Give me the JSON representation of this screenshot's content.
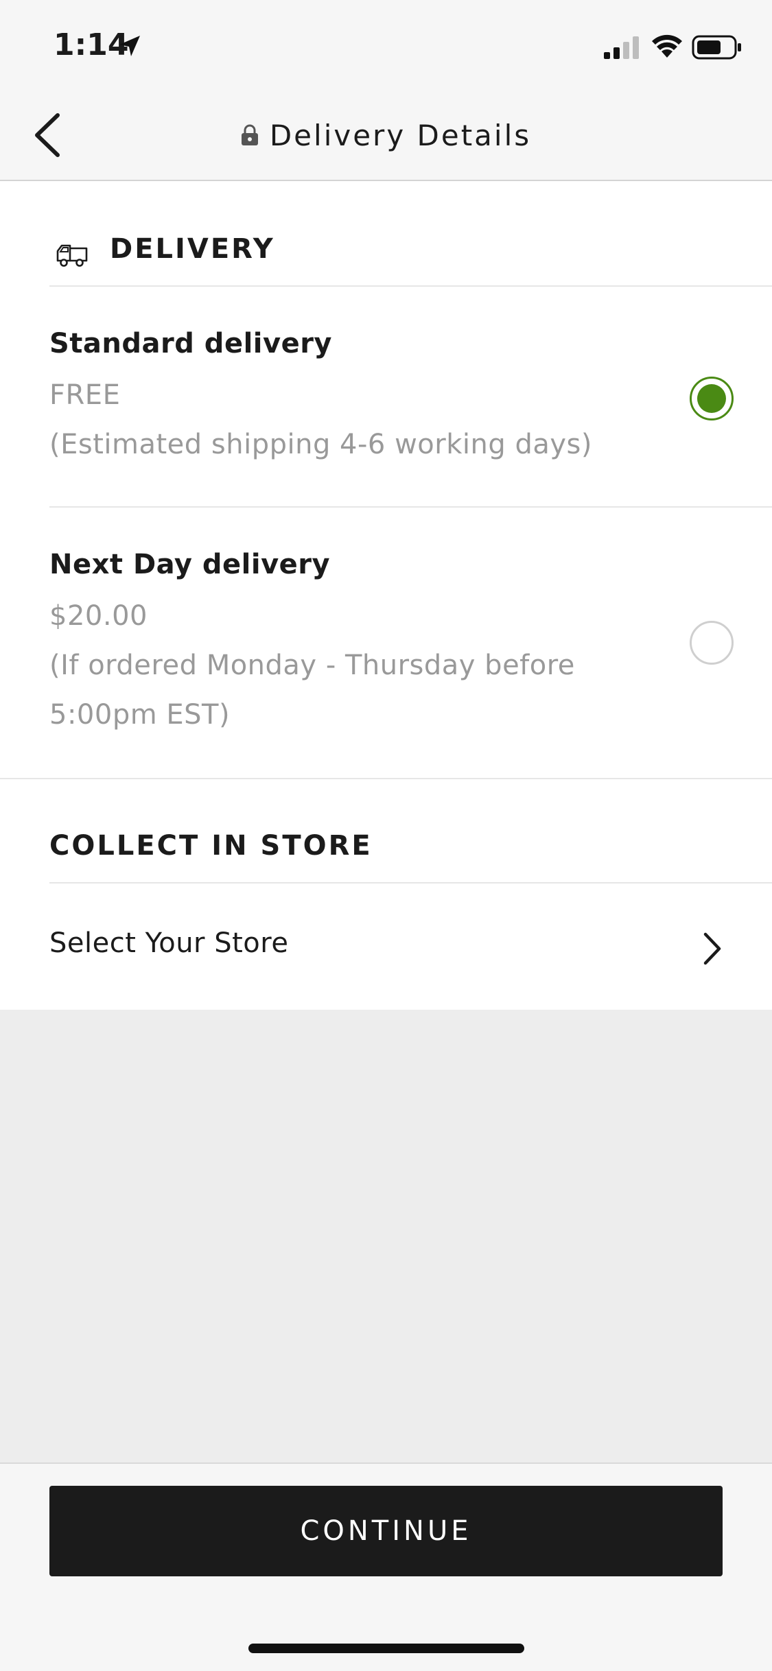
{
  "status_bar": {
    "time": "1:14"
  },
  "nav": {
    "title": "Delivery Details",
    "back_icon": "chevron-left-icon",
    "lock_icon": "lock-icon"
  },
  "delivery_section": {
    "title": "DELIVERY",
    "icon": "truck-icon",
    "options": [
      {
        "title": "Standard delivery",
        "price": "FREE",
        "note_lines": [
          "(Estimated shipping 4-6 working days)"
        ],
        "selected": true
      },
      {
        "title": "Next Day delivery",
        "price": "$20.00",
        "note_lines": [
          "(If ordered Monday - Thursday before",
          "5:00pm EST)"
        ],
        "selected": false
      }
    ]
  },
  "collect_section": {
    "title": "COLLECT IN STORE",
    "select_store_label": "Select Your Store"
  },
  "footer": {
    "continue_label": "CONTINUE"
  },
  "colors": {
    "accent_green": "#4a8a14",
    "button_black": "#1b1b1b",
    "muted_text": "#999999"
  }
}
